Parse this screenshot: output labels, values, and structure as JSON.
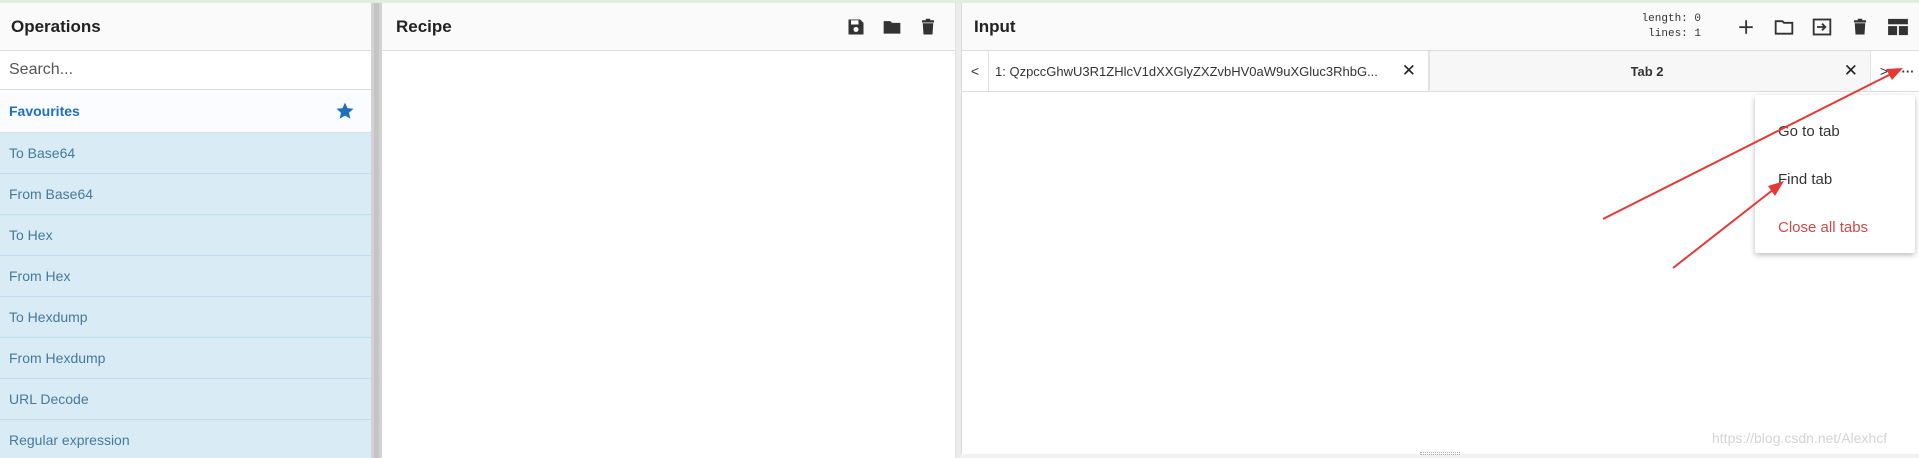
{
  "operations": {
    "title": "Operations",
    "search_placeholder": "Search...",
    "favourites_label": "Favourites",
    "items": [
      {
        "label": "To Base64"
      },
      {
        "label": "From Base64"
      },
      {
        "label": "To Hex"
      },
      {
        "label": "From Hex"
      },
      {
        "label": "To Hexdump"
      },
      {
        "label": "From Hexdump"
      },
      {
        "label": "URL Decode"
      },
      {
        "label": "Regular expression"
      }
    ]
  },
  "recipe": {
    "title": "Recipe",
    "icons": [
      "save-icon",
      "folder-icon",
      "trash-icon"
    ]
  },
  "input": {
    "title": "Input",
    "length_label": "length:",
    "length_value": "0",
    "lines_label": "lines:",
    "lines_value": "1",
    "icons": [
      "plus-icon",
      "folder-icon",
      "import-icon",
      "trash-icon",
      "layout-icon"
    ],
    "tab_prev": "<",
    "tab_next": ">",
    "tab_more": "···",
    "tabs": [
      {
        "label": "1: QzpccGhwU3R1ZHlcV1dXXGlyZXZvbHV0aW9uXGluc3RhbG...",
        "close": "✕"
      },
      {
        "label": "Tab 2",
        "close": "✕"
      }
    ],
    "menu": [
      {
        "label": "Go to tab"
      },
      {
        "label": "Find tab"
      },
      {
        "label": "Close all tabs"
      }
    ]
  },
  "colors": {
    "accent": "#1f6fbf",
    "op_bg": "#d9ecf6",
    "op_text": "#45799a",
    "danger": "#c94a4a",
    "arrow": "#e53935"
  },
  "watermark": "https://blog.csdn.net/Alexhcf"
}
